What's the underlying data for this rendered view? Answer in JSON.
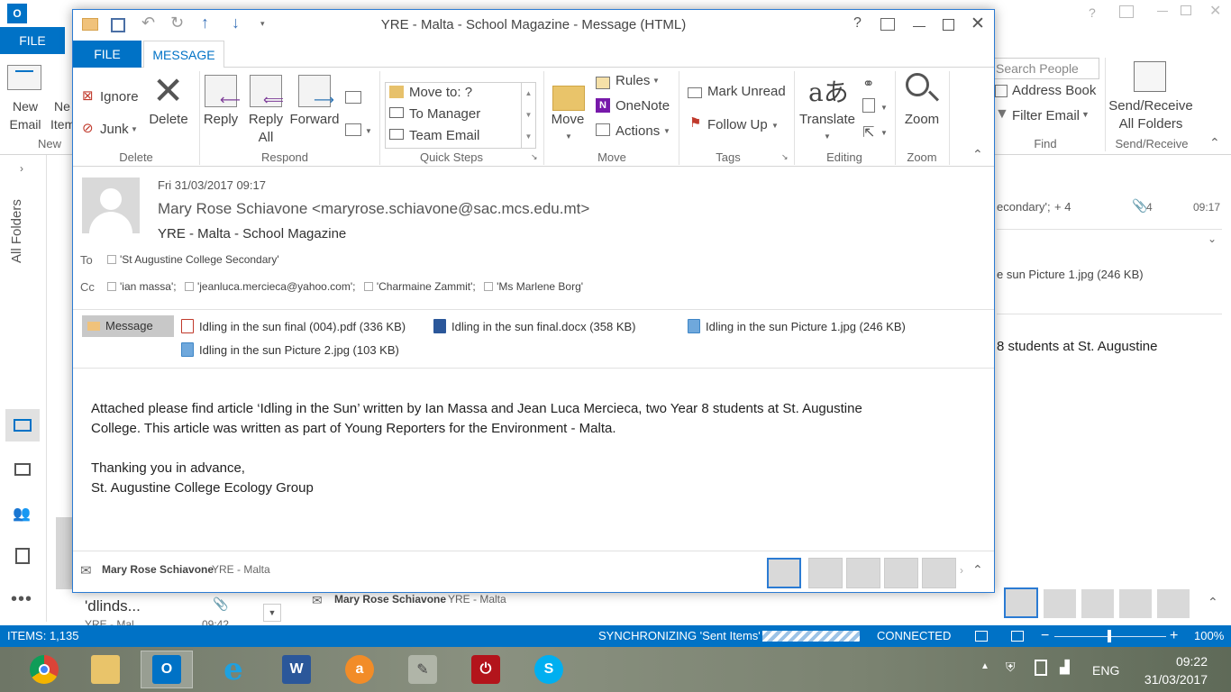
{
  "background_window": {
    "app_icon": "O",
    "file_tab": "FILE",
    "new_email": "New\nEmail",
    "new_items": "Ne\nItem",
    "new_group": "New",
    "search_people_placeholder": "Search People",
    "address_book": "Address Book",
    "filter_email": "Filter Email",
    "find_group": "Find",
    "send_receive": "Send/Receive\nAll Folders",
    "send_receive_group": "Send/Receive",
    "all_folders": "All Folders",
    "list_recipient_snippet": "econdary';",
    "list_more": "+ 4",
    "list_attach_count": "4",
    "list_time": "09:17",
    "attachment_snippet": "e sun Picture 1.jpg (246 KB)",
    "body_snippet": "8 students at St. Augustine",
    "list_item_subject": "'dlinds...",
    "list_item_from": "YRE - Mal",
    "list_item_time": "09:42",
    "people_pane_name": "Mary Rose Schiavone",
    "people_pane_sub": "YRE - Malta"
  },
  "message_window": {
    "title": "YRE - Malta - School Magazine - Message (HTML)",
    "tabs": {
      "file": "FILE",
      "message": "MESSAGE"
    },
    "ribbon": {
      "ignore": "Ignore",
      "junk": "Junk",
      "delete": "Delete",
      "delete_group": "Delete",
      "reply": "Reply",
      "reply_all": "Reply\nAll",
      "forward": "Forward",
      "respond_group": "Respond",
      "quick_steps": [
        "Move to: ?",
        "To Manager",
        "Team Email"
      ],
      "quick_steps_group": "Quick Steps",
      "move": "Move",
      "rules": "Rules",
      "onenote": "OneNote",
      "actions": "Actions",
      "move_group": "Move",
      "mark_unread": "Mark Unread",
      "follow_up": "Follow Up",
      "tags_group": "Tags",
      "translate": "Translate",
      "editing_group": "Editing",
      "zoom": "Zoom",
      "zoom_group": "Zoom"
    },
    "header": {
      "date": "Fri 31/03/2017 09:17",
      "from": "Mary Rose Schiavone <maryrose.schiavone@sac.mcs.edu.mt>",
      "subject": "YRE - Malta - School Magazine",
      "to_label": "To",
      "to": [
        "'St Augustine College Secondary'"
      ],
      "cc_label": "Cc",
      "cc": [
        "'ian massa';",
        "'jeanluca.mercieca@yahoo.com';",
        "'Charmaine Zammit';",
        "'Ms Marlene Borg'"
      ]
    },
    "attachments": {
      "message_tab": "Message",
      "files": [
        "Idling in the sun final (004).pdf (336 KB)",
        "Idling in the sun final.docx (358 KB)",
        "Idling in the sun Picture 1.jpg (246 KB)",
        "Idling in the sun Picture 2.jpg (103 KB)"
      ]
    },
    "body": {
      "paragraph1_line1": "Attached please find article ‘Idling in the Sun’ written by Ian Massa and Jean Luca Mercieca, two Year 8 students at St. Augustine",
      "paragraph1_line2": "College.  This article was written as part of Young Reporters for the Environment - Malta.",
      "thanks": "Thanking you in advance,",
      "signature": "St. Augustine College Ecology Group"
    },
    "people_pane": {
      "name": "Mary Rose Schiavone",
      "sub": "YRE - Malta"
    }
  },
  "status_bar": {
    "items": "ITEMS: 1,135",
    "sync": "SYNCHRONIZING  'Sent Items'",
    "connected": "CONNECTED",
    "zoom": "100%"
  },
  "taskbar": {
    "language": "ENG",
    "time": "09:22",
    "date": "31/03/2017"
  },
  "colors": {
    "accent": "#0072c6",
    "window_border": "#2b7bd3"
  }
}
